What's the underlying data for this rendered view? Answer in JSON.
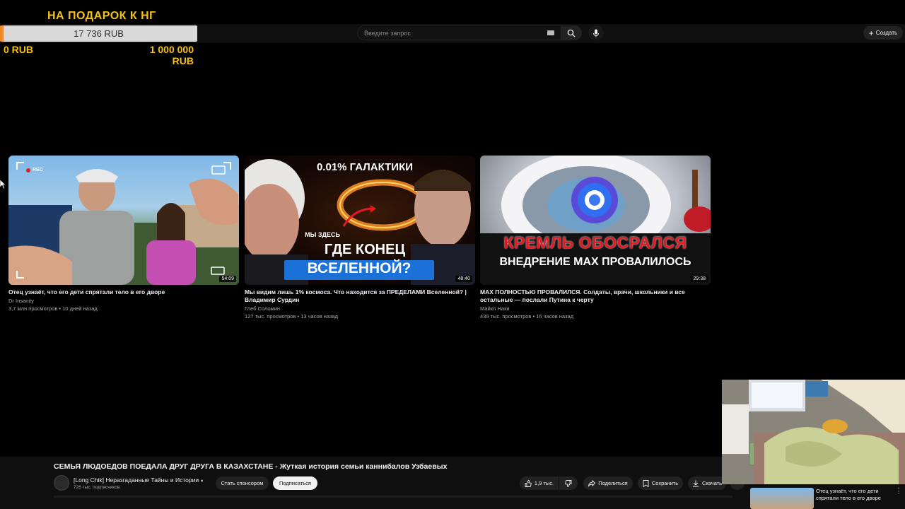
{
  "donation": {
    "title": "НА ПОДАРОК К НГ",
    "current": "17 736 RUB",
    "progress_fraction": 0.018,
    "min_label": "0 RUB",
    "max_label": "1 000 000 RUB",
    "fill_color": "#f08a24",
    "text_color": "#f5c211"
  },
  "header": {
    "search_placeholder": "Введите запрос",
    "create_label": "Создать",
    "icons": [
      "keyboard-icon",
      "search-icon",
      "mic-icon",
      "plus-icon"
    ]
  },
  "videos": [
    {
      "title": "Отец узнаёт, что его дети спрятали тело в его дворе",
      "channel": "Dr Insanity",
      "meta": "3,7 млн просмотров • 10 дней назад",
      "duration": "54:09",
      "thumb_text": "REC"
    },
    {
      "title": "Мы видим лишь 1% космоса. Что находится за ПРЕДЕЛАМИ Вселенной? | Владимир Сурдин",
      "channel": "Глеб Соломин",
      "meta": "127 тыс. просмотров • 13 часов назад",
      "duration": "48:40",
      "thumb_text_top": "0.01% ГАЛАКТИКИ",
      "thumb_text_here": "МЫ ЗДЕСЬ",
      "thumb_text_1": "ГДЕ КОНЕЦ",
      "thumb_text_2": "ВСЕЛЕННОЙ?"
    },
    {
      "title": "MAX ПОЛНОСТЬЮ ПРОВАЛИЛСЯ. Солдаты, врачи, школьники и все остальные — послали Путина к черту",
      "channel": "Майкл Наки",
      "meta": "439 тыс. просмотров • 16 часов назад",
      "duration": "29:38",
      "thumb_text_1": "КРЕМЛЬ ОБОСРАЛСЯ",
      "thumb_text_2": "ВНЕДРЕНИЕ МАХ ПРОВАЛИЛОСЬ"
    }
  ],
  "player": {
    "title": "СЕМЬЯ ЛЮДОЕДОВ ПОЕДАЛА ДРУГ ДРУГА В КАЗАХСТАНЕ - Жуткая история семьи каннибалов Узбаевых",
    "channel_name": "[Long Chik] Неразгаданные Тайны и Истории",
    "subscribers": "726 тыс. подписчиков",
    "sponsor_label": "Стать спонсором",
    "subscribe_label": "Подписаться",
    "likes": "1,9 тыс.",
    "share_label": "Поделиться",
    "save_label": "Сохранить",
    "download_label": "Скачать",
    "more_label": "•••"
  },
  "recommendation": {
    "title": "Отец узнаёт, что его дети спрятали тело в его дворе",
    "menu": "⋮"
  }
}
